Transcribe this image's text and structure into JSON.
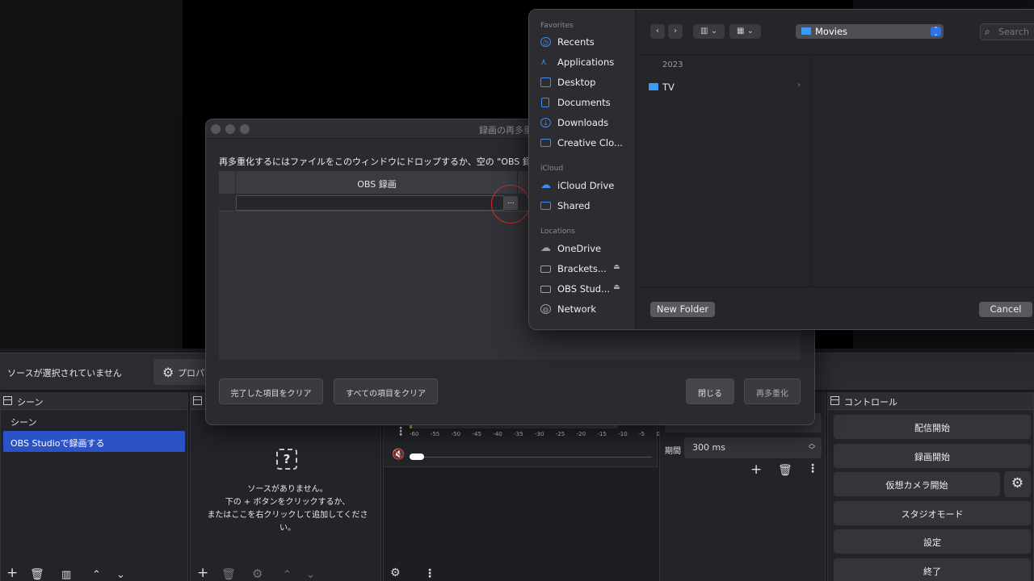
{
  "obs": {
    "no_source_selected": "ソースが選択されていません",
    "properties_label": "プロパテ",
    "scenes": {
      "title": "シーン",
      "items": [
        "シーン",
        "OBS Studioで録画する"
      ]
    },
    "sources": {
      "empty_text": "ソースがありません。\n下の + ボタンをクリックするか、\nまたはここを右クリックして追加してください。"
    },
    "mixer": {
      "scale": [
        "-60",
        "-55",
        "-50",
        "-45",
        "-40",
        "-35",
        "-30",
        "-25",
        "-20",
        "-15",
        "-10",
        "-5",
        "0"
      ]
    },
    "transitions": {
      "duration_label": "期間",
      "duration_value": "300 ms"
    },
    "controls": {
      "title": "コントロール",
      "buttons": [
        "配信開始",
        "録画開始",
        "仮想カメラ開始",
        "スタジオモード",
        "設定",
        "終了"
      ]
    }
  },
  "remux": {
    "title": "録画の再多重",
    "instructions": "再多重化するにはファイルをこのウィンドウにドロップするか、空の \"OBS 録画\" セル",
    "column_header": "OBS 録画",
    "browse": "...",
    "clear_finished": "完了した項目をクリア",
    "clear_all": "すべての項目をクリア",
    "close": "閉じる",
    "remux_button": "再多重化"
  },
  "picker": {
    "sidebar": {
      "favorites_head": "Favorites",
      "favorites": [
        {
          "label": "Recents",
          "icon": "clock-icon"
        },
        {
          "label": "Applications",
          "icon": "applications-icon"
        },
        {
          "label": "Desktop",
          "icon": "desktop-icon"
        },
        {
          "label": "Documents",
          "icon": "document-icon"
        },
        {
          "label": "Downloads",
          "icon": "download-icon"
        },
        {
          "label": "Creative Clo...",
          "icon": "folder-icon"
        }
      ],
      "icloud_head": "iCloud",
      "icloud": [
        {
          "label": "iCloud Drive",
          "icon": "cloud-icon"
        },
        {
          "label": "Shared",
          "icon": "shared-folder-icon"
        }
      ],
      "locations_head": "Locations",
      "locations": [
        {
          "label": "OneDrive",
          "icon": "cloud-icon"
        },
        {
          "label": "Brackets...",
          "icon": "disk-icon"
        },
        {
          "label": "OBS Stud...",
          "icon": "disk-icon"
        },
        {
          "label": "Network",
          "icon": "globe-icon"
        }
      ]
    },
    "location": "Movies",
    "search_placeholder": "Search",
    "column_head": "2023",
    "folder": "TV",
    "new_folder": "New Folder",
    "cancel": "Cancel",
    "accent": "#3d8cf5"
  }
}
